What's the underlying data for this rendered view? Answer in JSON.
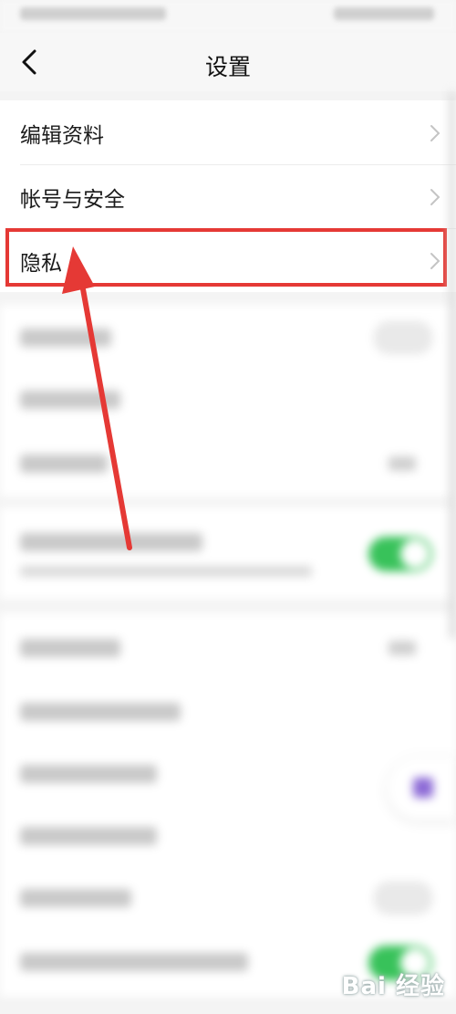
{
  "nav": {
    "title": "设置",
    "back_icon": "chevron-left-icon"
  },
  "settings": {
    "items": [
      {
        "label": "编辑资料",
        "icon": "chevron-right-icon"
      },
      {
        "label": "帐号与安全",
        "icon": "chevron-right-icon"
      },
      {
        "label": "隐私",
        "icon": "chevron-right-icon",
        "highlighted": true
      }
    ]
  },
  "annotation": {
    "highlight_color": "#e53935",
    "arrow_color": "#e53935"
  },
  "colors": {
    "toggle_on": "#38c25a",
    "background": "#f4f4f4"
  },
  "watermark": {
    "text": "Bai 经验"
  }
}
